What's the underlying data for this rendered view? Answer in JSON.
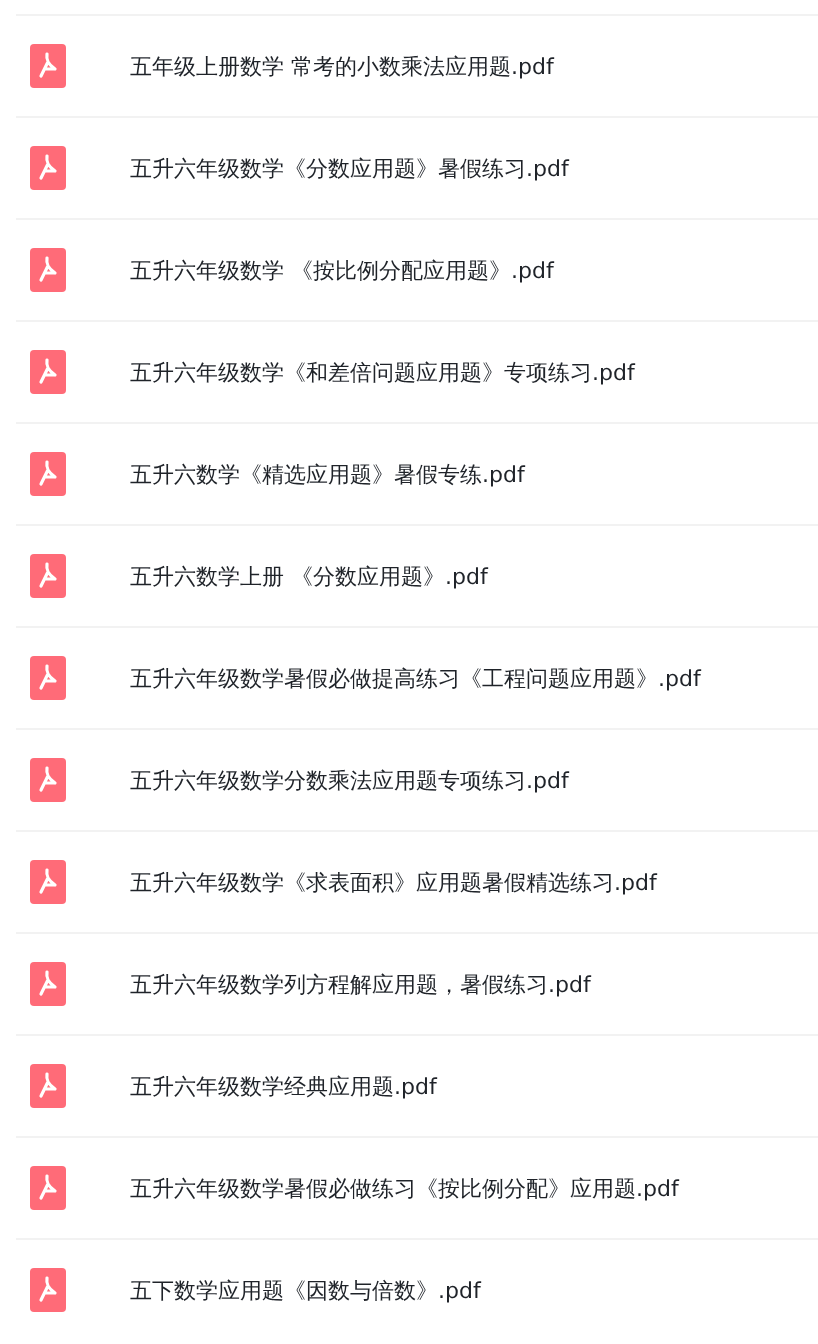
{
  "files": [
    {
      "name": "五年级上册数学 常考的小数乘法应用题.pdf",
      "kind": "pdf"
    },
    {
      "name": "五升六年级数学《分数应用题》暑假练习.pdf",
      "kind": "pdf"
    },
    {
      "name": "五升六年级数学 《按比例分配应用题》.pdf",
      "kind": "pdf"
    },
    {
      "name": "五升六年级数学《和差倍问题应用题》专项练习.pdf",
      "kind": "pdf"
    },
    {
      "name": "五升六数学《精选应用题》暑假专练.pdf",
      "kind": "pdf"
    },
    {
      "name": "五升六数学上册 《分数应用题》.pdf",
      "kind": "pdf"
    },
    {
      "name": "五升六年级数学暑假必做提高练习《工程问题应用题》.pdf",
      "kind": "pdf"
    },
    {
      "name": "五升六年级数学分数乘法应用题专项练习.pdf",
      "kind": "pdf"
    },
    {
      "name": "五升六年级数学《求表面积》应用题暑假精选练习.pdf",
      "kind": "pdf"
    },
    {
      "name": "五升六年级数学列方程解应用题，暑假练习.pdf",
      "kind": "pdf"
    },
    {
      "name": "五升六年级数学经典应用题.pdf",
      "kind": "pdf"
    },
    {
      "name": "五升六年级数学暑假必做练习《按比例分配》应用题.pdf",
      "kind": "pdf"
    },
    {
      "name": "五下数学应用题《因数与倍数》.pdf",
      "kind": "pdf"
    }
  ]
}
